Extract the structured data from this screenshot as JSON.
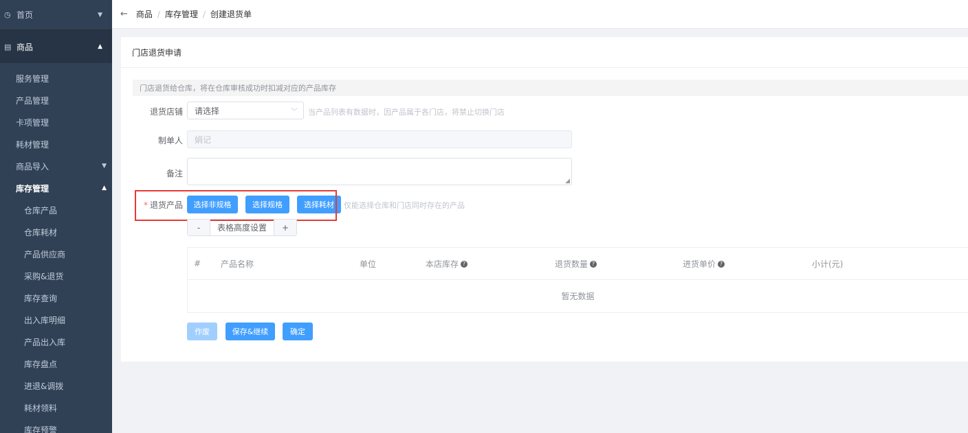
{
  "sidebar": {
    "home": "首页",
    "group": "商品",
    "items": [
      {
        "label": "服务管理"
      },
      {
        "label": "产品管理"
      },
      {
        "label": "卡项管理"
      },
      {
        "label": "耗材管理"
      },
      {
        "label": "商品导入"
      },
      {
        "label": "库存管理"
      }
    ],
    "sub_items": [
      "仓库产品",
      "仓库耗材",
      "产品供应商",
      "采购&退货",
      "库存查询",
      "出入库明细",
      "产品出入库",
      "库存盘点",
      "进退&调拨",
      "耗材领料",
      "库存预警"
    ]
  },
  "breadcrumb": {
    "items": [
      "商品",
      "库存管理",
      "创建退货单"
    ],
    "separator": "/"
  },
  "card": {
    "title": "门店退货申请",
    "notice": "门店退货给仓库，将在仓库审核成功时扣减对应的产品库存"
  },
  "form": {
    "store_label": "退货店铺",
    "store_placeholder": "请选择",
    "store_hint": "当产品列表有数据时，因产品属于各门店，将禁止切换门店",
    "maker_label": "制单人",
    "maker_value": "娟记",
    "remark_label": "备注",
    "product_label": "退货产品",
    "product_required": "*",
    "btn_non_spec": "选择非规格",
    "btn_spec": "选择规格",
    "btn_material": "选择耗材",
    "product_hint": "仅能选择仓库和门店同时存在的产品"
  },
  "stepper": {
    "minus": "-",
    "label": "表格高度设置",
    "plus": "+"
  },
  "table": {
    "columns": [
      "#",
      "产品名称",
      "单位",
      "本店库存",
      "退货数量",
      "进货单价",
      "小计(元)"
    ],
    "empty": "暂无数据"
  },
  "actions": {
    "void": "作废",
    "save_continue": "保存&继续",
    "confirm": "确定"
  }
}
